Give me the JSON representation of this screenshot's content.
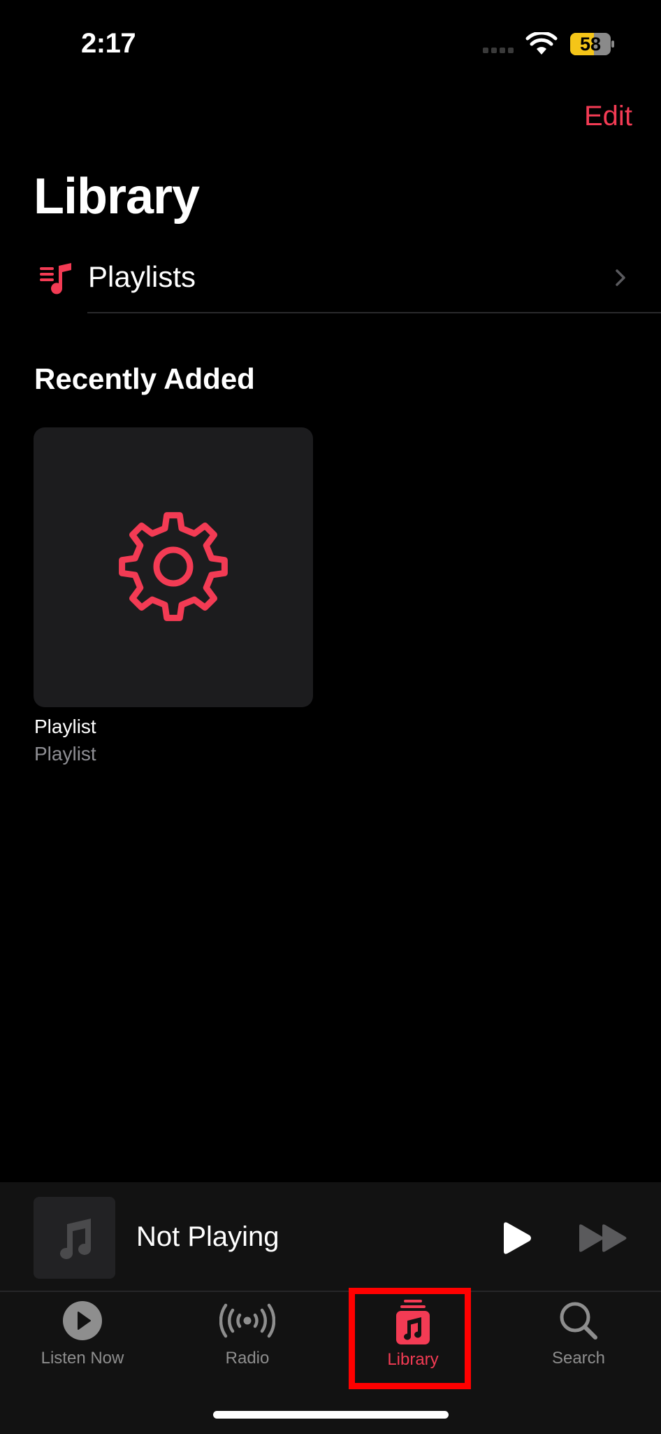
{
  "status_bar": {
    "time": "2:17",
    "battery_level": "58",
    "signal_icon": "cellular-signal-icon",
    "wifi_icon": "wifi-icon"
  },
  "nav": {
    "edit_label": "Edit"
  },
  "page": {
    "title": "Library"
  },
  "library_rows": [
    {
      "label": "Playlists",
      "icon": "playlist-icon"
    }
  ],
  "recently_added": {
    "heading": "Recently Added",
    "items": [
      {
        "title": "Playlist",
        "subtitle": "Playlist",
        "artwork_icon": "gear-icon"
      }
    ]
  },
  "mini_player": {
    "status": "Not Playing",
    "artwork_icon": "music-note-icon",
    "play_icon": "play-icon",
    "forward_icon": "fast-forward-icon"
  },
  "tab_bar": {
    "tabs": [
      {
        "label": "Listen Now",
        "icon": "listen-now-icon",
        "active": false
      },
      {
        "label": "Radio",
        "icon": "radio-icon",
        "active": false
      },
      {
        "label": "Library",
        "icon": "library-icon",
        "active": true
      },
      {
        "label": "Search",
        "icon": "search-icon",
        "active": false
      }
    ]
  },
  "colors": {
    "accent": "#f33b54",
    "background": "#000000",
    "tile_background": "#1c1c1e",
    "inactive_tab": "#8e8e8e",
    "highlight_box": "#ff0000",
    "battery_fill": "#f5c518"
  }
}
